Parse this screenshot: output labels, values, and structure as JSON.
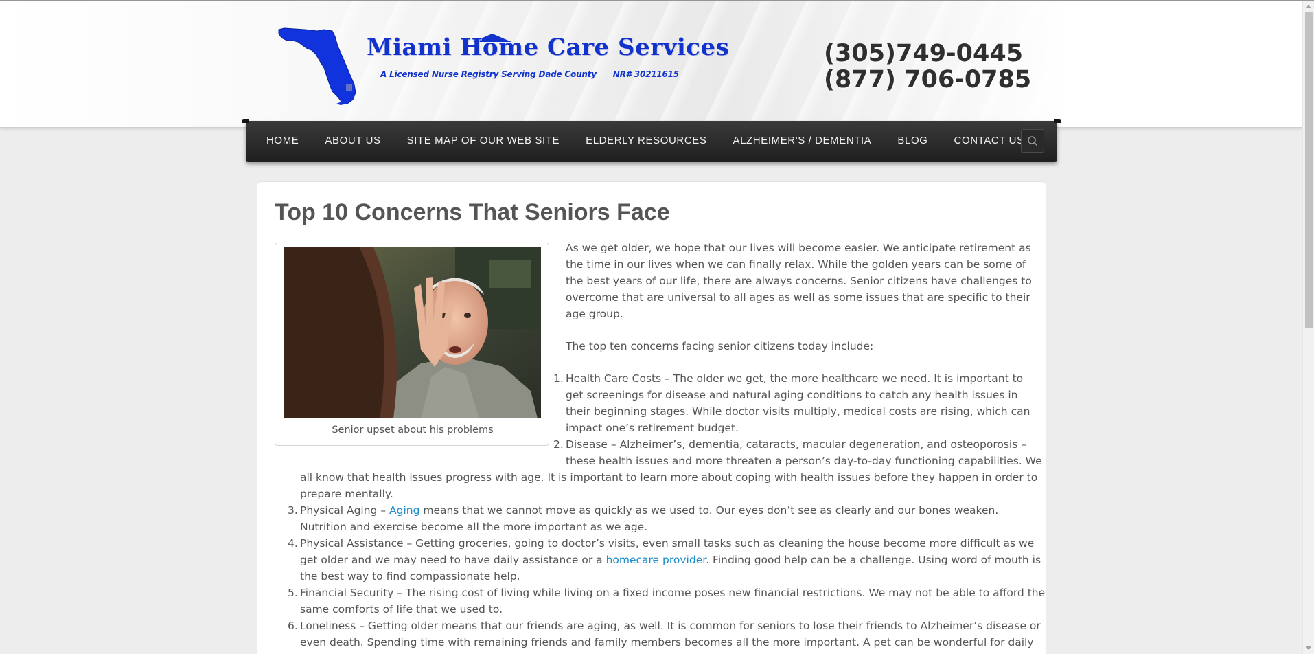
{
  "header": {
    "logo_title_part1": "Miami Home Care Services",
    "logo_subtitle": "A Licensed Nurse Registry Serving Dade County      NR# 30211615",
    "phone_1": "(305)749-0445",
    "phone_2": "(877) 706-0785",
    "logo_color": "#1133cc"
  },
  "nav": {
    "items": [
      {
        "label": "HOME"
      },
      {
        "label": "ABOUT US"
      },
      {
        "label": "SITE MAP OF OUR WEB SITE"
      },
      {
        "label": "ELDERLY RESOURCES"
      },
      {
        "label": "ALZHEIMER'S / DEMENTIA"
      },
      {
        "label": "BLOG"
      },
      {
        "label": "CONTACT US"
      }
    ],
    "search_icon": "search-icon"
  },
  "article": {
    "title": "Top 10 Concerns That Seniors Face",
    "image_caption": "Senior upset about his problems",
    "intro_lines": [
      "As we get older, we hope that our lives will become easier. We anticipate retirement as",
      "the time in our lives when we can finally relax. While the golden years can be some of",
      "the best years of our life, there are always concerns. Senior citizens have challenges to",
      "overcome that are universal to all ages as well as some issues that are specific to their",
      "age group."
    ],
    "lead_in": "The top ten concerns facing senior citizens today include:",
    "list": [
      {
        "number": "1.",
        "lines": [
          "Health Care Costs – The older we get, the more healthcare we need. It is important to",
          "get screenings for disease and natural aging conditions to catch any health issues in",
          "their beginning stages. While doctor visits multiply, medical costs are rising, which can",
          "impact one’s retirement budget."
        ]
      },
      {
        "number": "2.",
        "lines": [
          "Disease – Alzheimer’s, dementia, cataracts, macular degeneration, and osteoporosis –",
          "these health issues and more threaten a person’s day-to-day functioning capabilities. We",
          "all know that health issues progress with age. It is important to learn more about coping with health issues before they happen in order to",
          "prepare mentally."
        ]
      },
      {
        "number": "3.",
        "line1_before": "Physical Aging – ",
        "line1_link": "Aging",
        "line1_after": " means that we cannot move as quickly as we used to. Our eyes don’t see as clearly and our bones weaken.",
        "line2": "Nutrition and exercise become all the more important as we age."
      },
      {
        "number": "4.",
        "line1": "Physical Assistance – Getting groceries, going to doctor’s visits, even small tasks such as cleaning the house become more difficult as we",
        "line2_before": "get older and we may need to have daily assistance or a ",
        "line2_link": "homecare provider",
        "line2_after": ". Finding good help can be a challenge. Using word of mouth is",
        "line3": "the best way to find compassionate help."
      },
      {
        "number": "5.",
        "lines": [
          "Financial Security – The rising cost of living while living on a fixed income poses new financial restrictions. We may not be able to afford the",
          "same comforts of life that we used to."
        ]
      },
      {
        "number": "6.",
        "lines": [
          "Loneliness – Getting older means that our friends are aging, as well. It is common for seniors to lose their friends to Alzheimer’s disease or",
          "even death. Spending time with remaining friends and family members becomes all the more important. A pet can be wonderful for daily"
        ]
      }
    ],
    "link_color": "#1a8cc9"
  }
}
